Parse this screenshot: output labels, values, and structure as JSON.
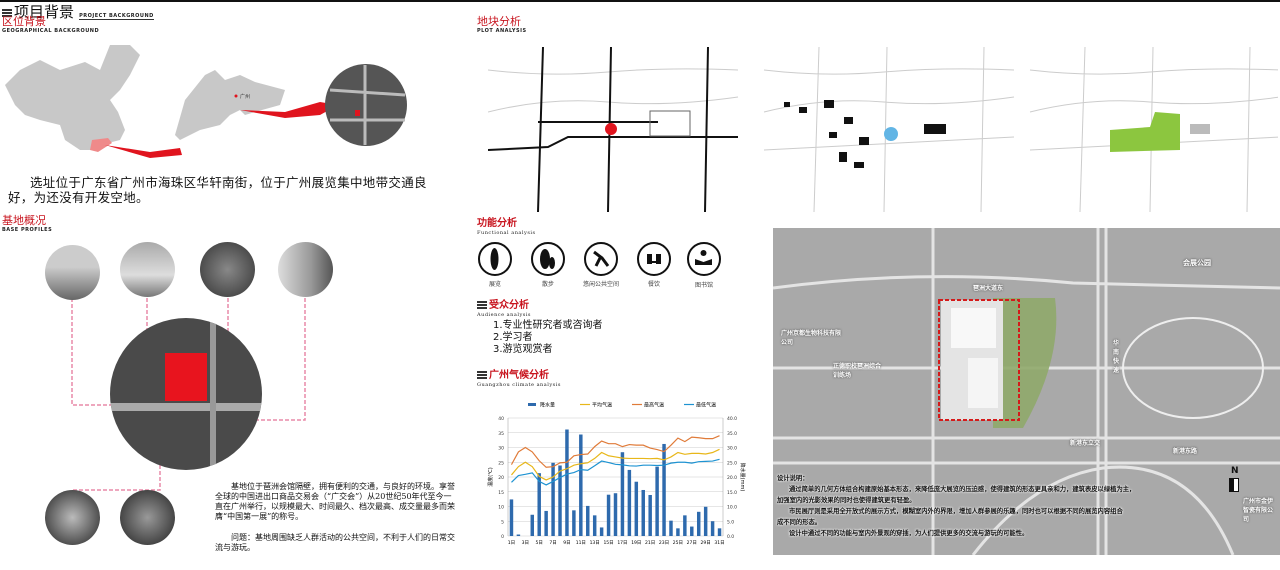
{
  "header": {
    "title": "项目背景",
    "title_en": "PROJECT BACKGROUND"
  },
  "location": {
    "title": "区位背景",
    "title_en": "GEOGRAPHICAL BACKGROUND",
    "map_label": "广州",
    "desc": "选址位于广东省广州市海珠区华轩南街，位于广州展览集中地带交通良好，为还没有开发空地。"
  },
  "plot": {
    "title": "地块分析",
    "title_en": "PLOT ANALYSIS"
  },
  "base": {
    "title": "基地概况",
    "title_en": "BASE PROFILES",
    "desc1": "基地位于琶洲会馆隔壁，拥有便利的交通，与良好的环境。享誉全球的中国进出口商品交易会（“广交会”）从20世纪50年代至今一直在广州举行，以规模最大、时间最久、档次最高、成交量最多而荣膺“中国第一展”的称号。",
    "desc2": "问题：基地周围缺乏人群活动的公共空间，不利于人们的日常交流与游玩。"
  },
  "functional": {
    "title": "功能分析",
    "title_en": "Functional analysis",
    "items": [
      {
        "label": "展览",
        "icon": "standing-person-icon"
      },
      {
        "label": "散步",
        "icon": "walking-people-icon"
      },
      {
        "label": "悠闲公共空间",
        "icon": "skater-icon"
      },
      {
        "label": "餐饮",
        "icon": "dining-icon"
      },
      {
        "label": "图书馆",
        "icon": "reading-icon"
      }
    ]
  },
  "audience": {
    "title": "受众分析",
    "title_en": "Audience analysis",
    "items": [
      "1.专业性研究者或咨询者",
      "2.学习者",
      "3.游览观赏者"
    ]
  },
  "climate": {
    "title": "广州气候分析",
    "title_en": "Guangzhou climate analysis"
  },
  "chart_data": {
    "type": "bar+line",
    "categories": [
      "1日",
      "2日",
      "3日",
      "4日",
      "5日",
      "6日",
      "7日",
      "8日",
      "9日",
      "10日",
      "11日",
      "12日",
      "13日",
      "14日",
      "15日",
      "16日",
      "17日",
      "18日",
      "19日",
      "20日",
      "21日",
      "22日",
      "23日",
      "24日",
      "25日",
      "26日",
      "27日",
      "28日",
      "29日",
      "30日",
      "31日"
    ],
    "tick_labels": [
      "1日",
      "3日",
      "5日",
      "7日",
      "9日",
      "11日",
      "13日",
      "15日",
      "17日",
      "19日",
      "21日",
      "23日",
      "25日",
      "27日",
      "29日",
      "31日"
    ],
    "left_ylabel": "温度(℃)",
    "left_ylim": [
      0,
      40
    ],
    "left_ticks": [
      "0",
      "5",
      "10",
      "15",
      "20",
      "25",
      "30",
      "35",
      "40"
    ],
    "right_ylabel": "降水量(mm)",
    "right_ylim": [
      0,
      40
    ],
    "right_ticks": [
      "0.0",
      "5.0",
      "10.0",
      "15.0",
      "20.0",
      "25.0",
      "30.0",
      "35.0",
      "40.0"
    ],
    "legend_position": "top",
    "series": [
      {
        "name": "降水量",
        "type": "bar",
        "axis": "right",
        "color": "#2e6aad",
        "values": [
          12.4,
          0.5,
          0,
          7.2,
          21.3,
          8.5,
          24.8,
          23.9,
          36.1,
          8.7,
          34.4,
          10.2,
          7.0,
          2.9,
          14.0,
          14.5,
          28.4,
          22.4,
          18.4,
          15.6,
          13.9,
          23.5,
          31.2,
          5.2,
          2.6,
          7.0,
          3.2,
          8.2,
          9.9,
          5.0,
          2.6
        ]
      },
      {
        "name": "平均气温",
        "type": "line",
        "axis": "left",
        "color": "#e8b71a",
        "values": [
          20.7,
          23.5,
          25,
          23.5,
          20.2,
          19,
          20,
          22,
          22.8,
          24,
          24.5,
          24.8,
          26.3,
          28.3,
          27.2,
          26.8,
          26.4,
          26.3,
          26.3,
          26.3,
          26.2,
          26.3,
          25.8,
          26.8,
          28.3,
          27.7,
          28,
          28,
          27.8,
          28.3,
          29.4
        ]
      },
      {
        "name": "最高气温",
        "type": "line",
        "axis": "left",
        "color": "#e07b39",
        "values": [
          24.2,
          28.5,
          30,
          28.5,
          25.5,
          23.3,
          23.5,
          24.8,
          25,
          27.2,
          27.6,
          27.8,
          30.3,
          32.2,
          31.3,
          31.3,
          30.3,
          31,
          30.8,
          30.8,
          29.8,
          29.3,
          28.6,
          30.8,
          33.2,
          32,
          33.5,
          33.3,
          33,
          33,
          34
        ]
      },
      {
        "name": "最低气温",
        "type": "line",
        "axis": "left",
        "color": "#1e93d2",
        "values": [
          18.2,
          20.5,
          20.9,
          21.4,
          18.5,
          17.3,
          18.5,
          19.8,
          21,
          21.5,
          22.5,
          22.3,
          23.8,
          25.4,
          24.9,
          24.3,
          24.1,
          23.8,
          23.7,
          24,
          24,
          23.9,
          24,
          24.7,
          25,
          25,
          24.7,
          25.2,
          25.3,
          25.4,
          26
        ]
      }
    ]
  },
  "satellite": {
    "labels": [
      "会展公园",
      "广州京都生物科技有限公司",
      "正德职校琶洲综合训练场",
      "新港东立交",
      "新港东路",
      "琶洲大道东",
      "华南快速",
      "广州市金伊智瓷有限公司"
    ],
    "north": "N",
    "design_title": "设计说明：",
    "design_lines": [
      "通过简单的几何方体组合构建原始基本形态，来降低庞大展览的压迫感，使得建筑的形态更具亲和力，建筑表皮以绿植为主，",
      "加强室内的光影效果的同时也使得建筑更有轻盈。",
      "市民展厅则是采用全开放式的展示方式，模糊室内外的界限，增加人群参展的乐趣，同时也可以根据不同的展览内容组合",
      "成不同的形态。",
      "设计中通过不同的功能与室内外景观的穿插，为人们提供更多的交流与游玩的可能性。"
    ]
  },
  "colors": {
    "accent": "#c8141e",
    "green": "#8cc63f",
    "blue": "#62b5e5"
  }
}
